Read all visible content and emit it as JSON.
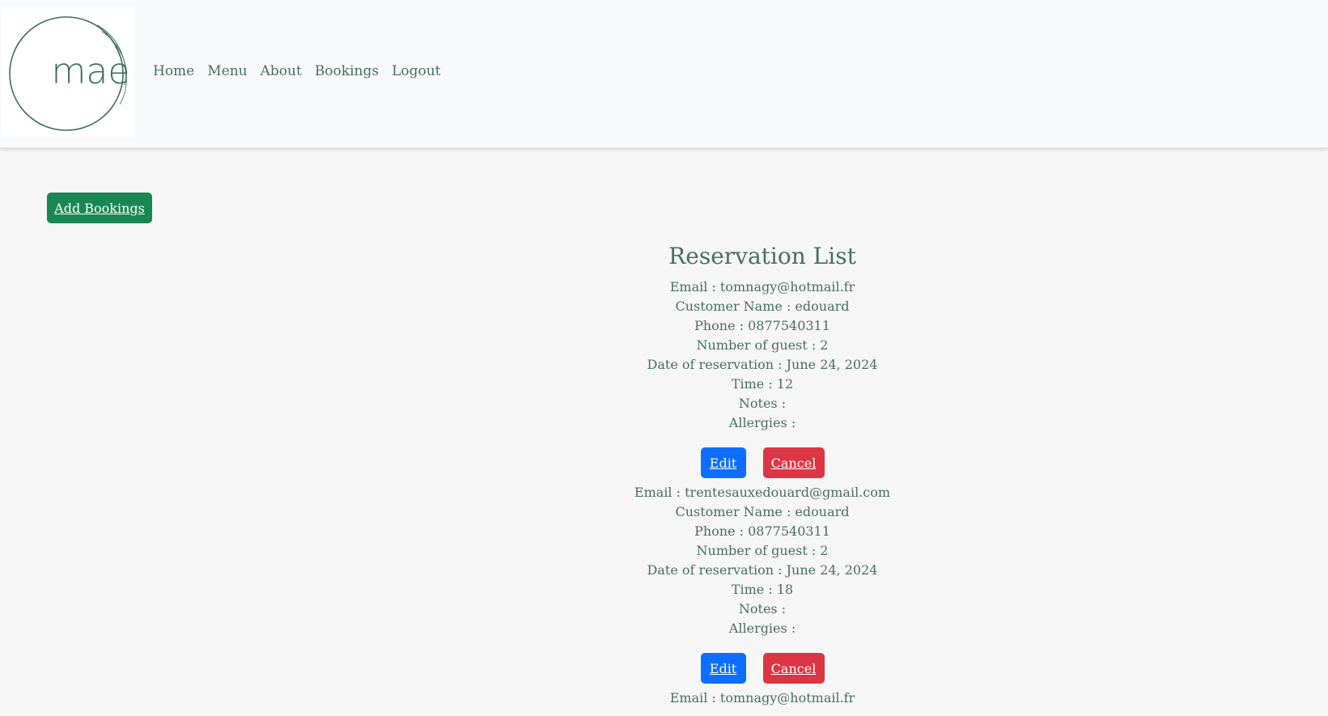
{
  "brand": {
    "logo_text": "mae"
  },
  "nav": {
    "items": [
      "Home",
      "Menu",
      "About",
      "Bookings",
      "Logout"
    ]
  },
  "add_bookings_label": "Add Bookings",
  "list_title": "Reservation List",
  "reservations": [
    {
      "email": "Email : tomnagy@hotmail.fr",
      "name": "Customer Name : edouard",
      "phone": "Phone : 0877540311",
      "guests": "Number of guest : 2",
      "date": "Date of reservation : June 24, 2024",
      "time": "Time : 12",
      "notes": "Notes :",
      "allergies": "Allergies :",
      "edit_label": "Edit",
      "cancel_label": "Cancel"
    },
    {
      "email": "Email : trentesauxedouard@gmail.com",
      "name": "Customer Name : edouard",
      "phone": "Phone : 0877540311",
      "guests": "Number of guest : 2",
      "date": "Date of reservation : June 24, 2024",
      "time": "Time : 18",
      "notes": "Notes :",
      "allergies": "Allergies :",
      "edit_label": "Edit",
      "cancel_label": "Cancel"
    },
    {
      "email": "Email : tomnagy@hotmail.fr"
    }
  ],
  "colors": {
    "text": "#4a6e5f",
    "add_button": "#198754",
    "edit_button": "#0d6efd",
    "cancel_button": "#dc3545",
    "navbar_bg": "#f8f9fa",
    "page_bg": "#f6f6f6"
  }
}
